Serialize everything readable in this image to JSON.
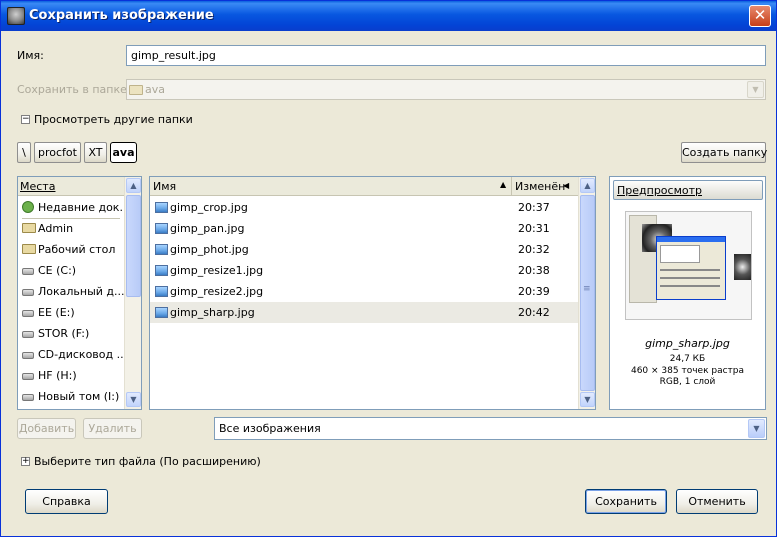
{
  "window": {
    "title": "Сохранить изображение",
    "close_glyph": "✕"
  },
  "name_row": {
    "label": "Имя:",
    "value": "gimp_result.jpg"
  },
  "folder_row": {
    "label": "Сохранить в папке",
    "value": "ava"
  },
  "browse_toggle": {
    "glyph": "⊟",
    "label": "Просмотреть другие папки"
  },
  "path_bar": {
    "buttons": [
      "\\",
      "procfot",
      "XT",
      "ava"
    ]
  },
  "create_folder_label": "Создать папку",
  "places": {
    "header": "Места",
    "items": [
      {
        "label": "Недавние док...",
        "icon": "recent-icon"
      },
      {
        "label": "Admin",
        "icon": "folder-icon"
      },
      {
        "label": "Рабочий стол",
        "icon": "folder-icon"
      },
      {
        "label": "CE (C:)",
        "icon": "drive-icon"
      },
      {
        "label": "Локальный д...",
        "icon": "drive-icon"
      },
      {
        "label": "EE (E:)",
        "icon": "drive-icon"
      },
      {
        "label": "STOR (F:)",
        "icon": "drive-icon"
      },
      {
        "label": "CD-дисковод ...",
        "icon": "drive-icon"
      },
      {
        "label": "HF (H:)",
        "icon": "drive-icon"
      },
      {
        "label": "Новый том (I:)",
        "icon": "drive-icon"
      }
    ]
  },
  "places_buttons": {
    "add": "Добавить",
    "remove": "Удалить"
  },
  "files": {
    "col_name": "Имя",
    "col_modified": "Изменён",
    "sort_glyph": "▲",
    "rows": [
      {
        "name": "gimp_crop.jpg",
        "time": "20:37"
      },
      {
        "name": "gimp_pan.jpg",
        "time": "20:31"
      },
      {
        "name": "gimp_phot.jpg",
        "time": "20:32"
      },
      {
        "name": "gimp_resize1.jpg",
        "time": "20:38"
      },
      {
        "name": "gimp_resize2.jpg",
        "time": "20:39"
      },
      {
        "name": "gimp_sharp.jpg",
        "time": "20:42"
      }
    ],
    "selected_index": 5
  },
  "preview": {
    "header": "Предпросмотр",
    "filename": "gimp_sharp.jpg",
    "size": "24,7 КБ",
    "dimensions": "460 × 385 точек растра",
    "mode": "RGB, 1 слой"
  },
  "filter": {
    "value": "Все изображения"
  },
  "file_type_toggle": {
    "glyph": "⊞",
    "label": "Выберите тип файла (По расширению)"
  },
  "buttons": {
    "help": "Справка",
    "save": "Сохранить",
    "cancel": "Отменить"
  },
  "glyphs": {
    "up": "▲",
    "down": "▼",
    "left": "◀",
    "grip": "≡"
  }
}
